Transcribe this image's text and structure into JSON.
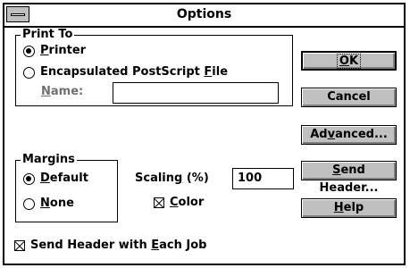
{
  "window": {
    "title": "Options"
  },
  "print_to": {
    "legend": "Print To",
    "printer": {
      "prefix": "",
      "accel": "P",
      "suffix": "rinter",
      "selected": true
    },
    "eps_file": {
      "prefix": "Encapsulated PostScript ",
      "accel": "F",
      "suffix": "ile",
      "selected": false
    },
    "name_label": {
      "prefix": "",
      "accel": "N",
      "suffix": "ame:"
    },
    "name_value": ""
  },
  "margins": {
    "legend": "Margins",
    "default": {
      "prefix": "",
      "accel": "D",
      "suffix": "efault",
      "selected": true
    },
    "none": {
      "prefix": "",
      "accel": "N",
      "suffix": "one",
      "selected": false
    }
  },
  "scaling": {
    "prefix": "Scalin",
    "accel": "g",
    "suffix": " (%)",
    "value": "100"
  },
  "color": {
    "prefix": "",
    "accel": "C",
    "suffix": "olor",
    "checked": true
  },
  "send_header_each_job": {
    "prefix": "Send Header with ",
    "accel": "E",
    "suffix": "ach Job",
    "checked": true
  },
  "buttons": {
    "ok": {
      "prefix": "",
      "accel": "O",
      "suffix": "K"
    },
    "cancel": {
      "prefix": "Cancel",
      "accel": "",
      "suffix": ""
    },
    "advanced": {
      "prefix": "Ad",
      "accel": "v",
      "suffix": "anced..."
    },
    "send_header": {
      "prefix": "",
      "accel": "S",
      "suffix": "end Header..."
    },
    "help": {
      "prefix": "",
      "accel": "H",
      "suffix": "elp"
    }
  }
}
